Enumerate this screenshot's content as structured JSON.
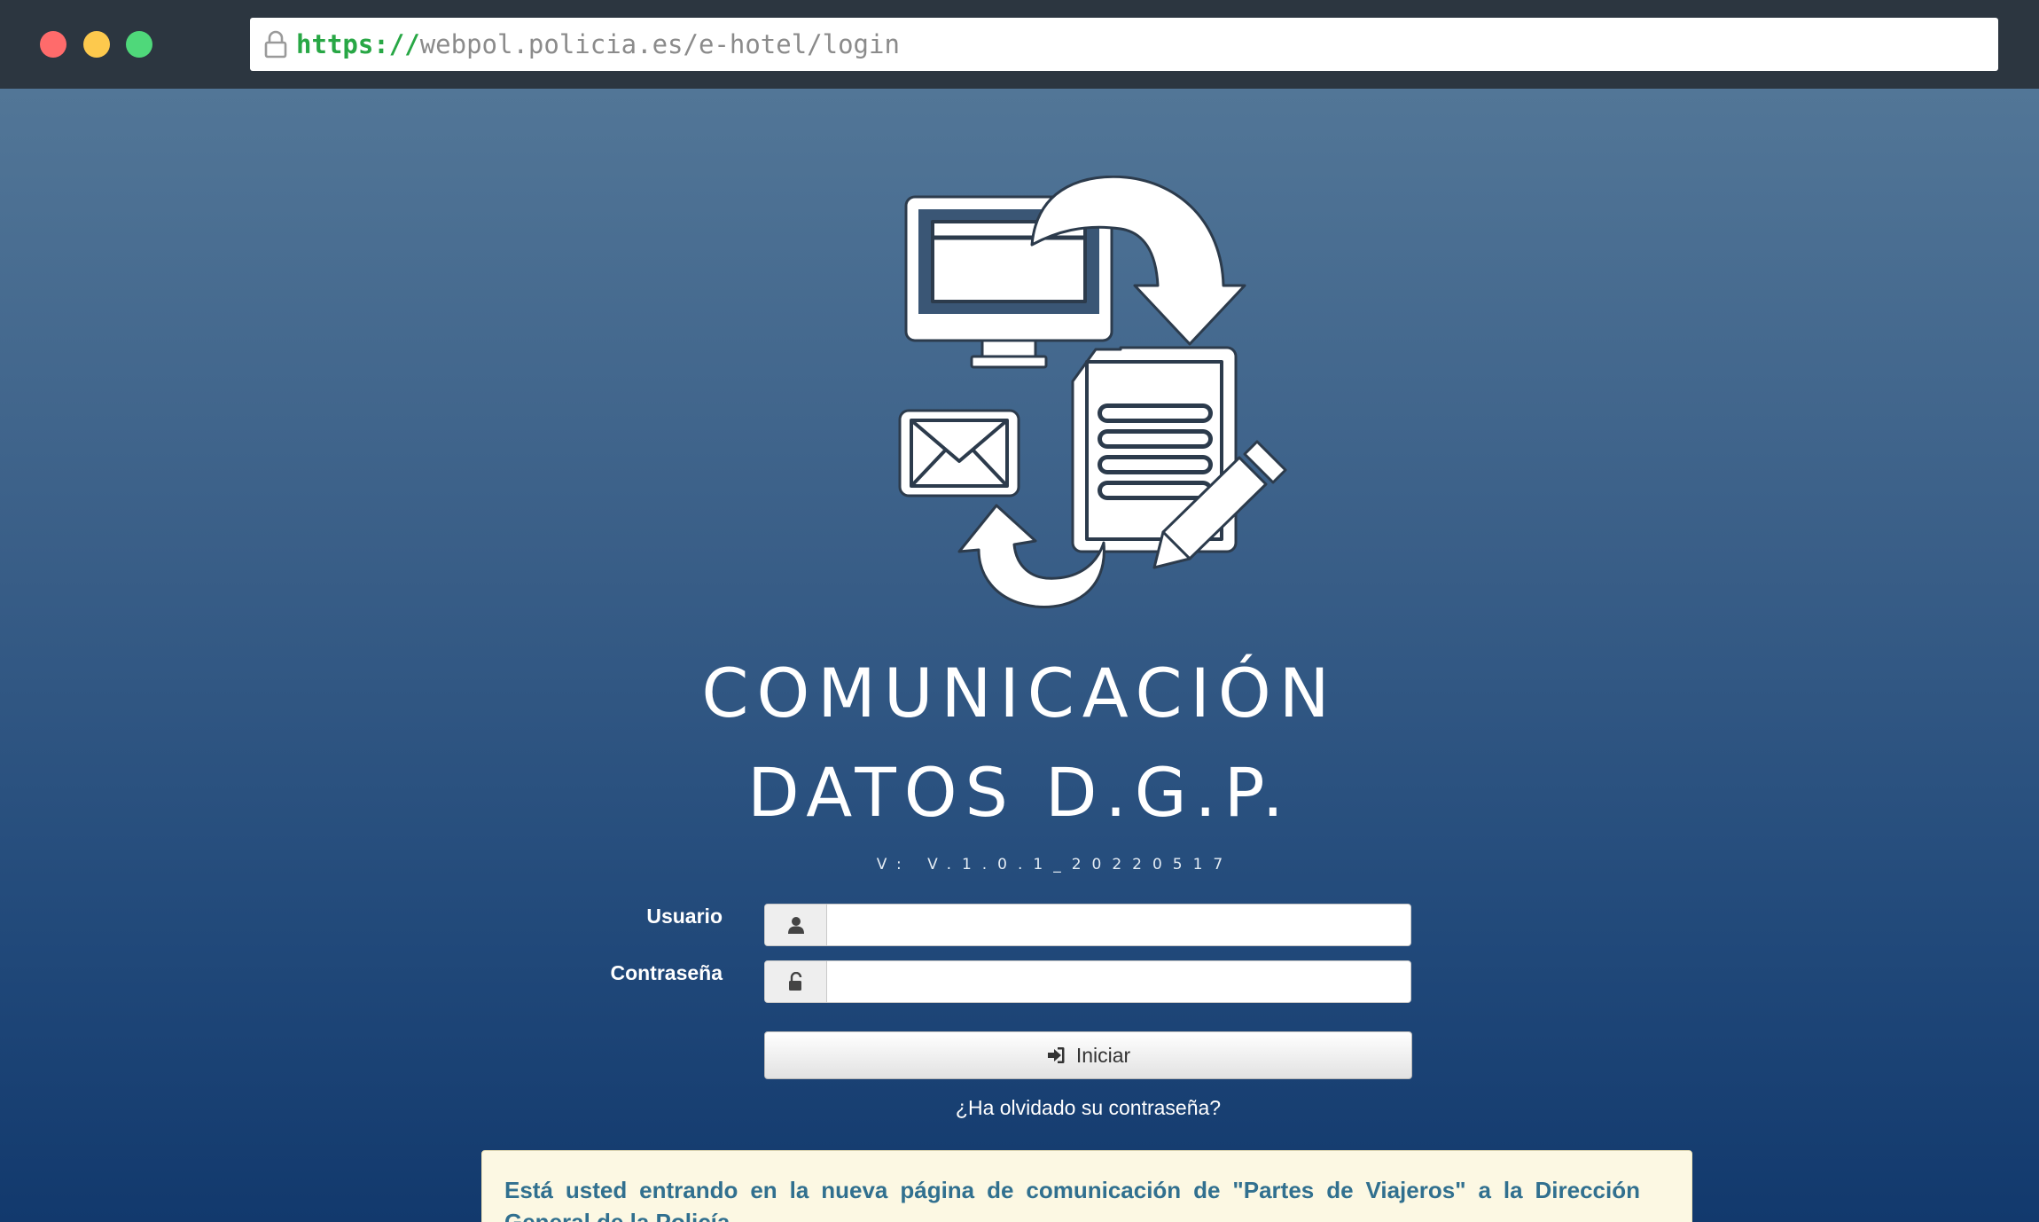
{
  "browser": {
    "url_protocol": "https://",
    "url_rest": "webpol.policia.es/e-hotel/login"
  },
  "app": {
    "title_line1": "COMUNICACIÓN",
    "title_line2": "DATOS D.G.P.",
    "version": "V: V.1.0.1_20220517"
  },
  "form": {
    "user_label": "Usuario",
    "password_label": "Contraseña",
    "user_value": "",
    "password_value": "",
    "login_label": "Iniciar",
    "forgot_label": "¿Ha olvidado su contraseña?"
  },
  "notice": {
    "text": "Está usted entrando en la nueva página de comunicación de \"Partes de Viajeros\" a la Dirección General de la Policía."
  },
  "icons": {
    "lock": "lock-icon",
    "logo": "communication-logo",
    "user": "user-icon",
    "password": "unlock-icon",
    "login": "sign-in-icon"
  },
  "colors": {
    "chrome": "#2c3640",
    "background_top": "#527697",
    "background_bottom": "#12396d",
    "protocol": "#28a745",
    "notice_bg": "#fcf8e3",
    "notice_text": "#31708f"
  }
}
